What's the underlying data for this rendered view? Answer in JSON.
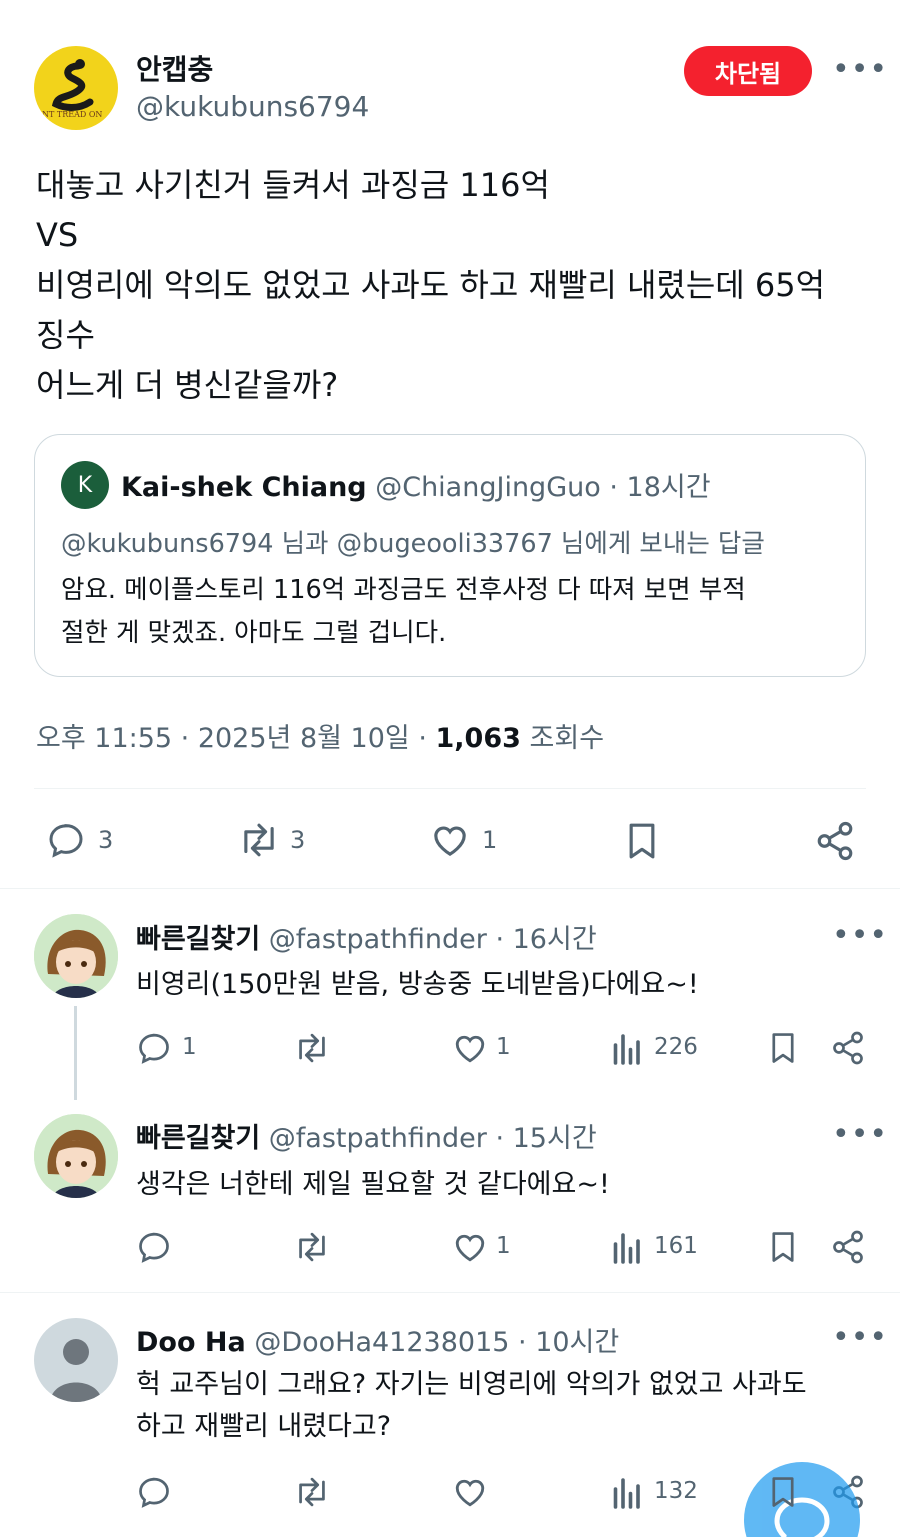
{
  "post": {
    "display_name": "안캡충",
    "handle": "@kukubuns6794",
    "avatar_text": "NT TREAD ON",
    "blocked_label": "차단됨",
    "text_lines": [
      "대놓고 사기친거 들켜서 과징금 116억",
      "VS",
      "비영리에 악의도 없었고 사과도 하고 재빨리 내렸는데 65억",
      "징수",
      "어느게 더 병신같을까?"
    ],
    "quote": {
      "avatar_letter": "K",
      "display_name": "Kai-shek Chiang",
      "handle": "@ChiangJingGuo",
      "time": "· 18시간",
      "reply_to": "@kukubuns6794 님과 @bugeooli33767 님에게 보내는 답글",
      "text_line1": "암요. 메이플스토리 116억 과징금도 전후사정 다 따져 보면 부적",
      "text_line2": "절한 게 맞겠죠. 아마도 그럴 겁니다."
    },
    "timestamp": "오후 11:55 · 2025년 8월 10일 ·",
    "views_count": "1,063",
    "views_label": "조회수",
    "actions": {
      "replies": "3",
      "retweets": "3",
      "likes": "1"
    }
  },
  "replies": [
    {
      "display_name": "빠른길찾기",
      "handle": "@fastpathfinder",
      "time": "· 16시간",
      "text": "비영리(150만원 받음, 방송중 도네받음)다에요~!",
      "reply_count": "1",
      "like_count": "1",
      "view_count": "226"
    },
    {
      "display_name": "빠른길찾기",
      "handle": "@fastpathfinder",
      "time": "· 15시간",
      "text": "생각은 너한테 제일 필요할 것 같다에요~!",
      "like_count": "1",
      "view_count": "161"
    },
    {
      "display_name": "Doo Ha",
      "handle": "@DooHa41238015",
      "time": "· 10시간",
      "text_line1": "헉 교주님이 그래요? 자기는 비영리에 악의가 없었고 사과도",
      "text_line2": "하고 재빨리 내렸다고?",
      "view_count": "132"
    }
  ],
  "colors": {
    "blocked_red": "#f4212e",
    "fab_blue": "#1d9bf0",
    "quote_avatar_green": "#1b5e3b",
    "avatar_yellow": "#f2d31b"
  }
}
